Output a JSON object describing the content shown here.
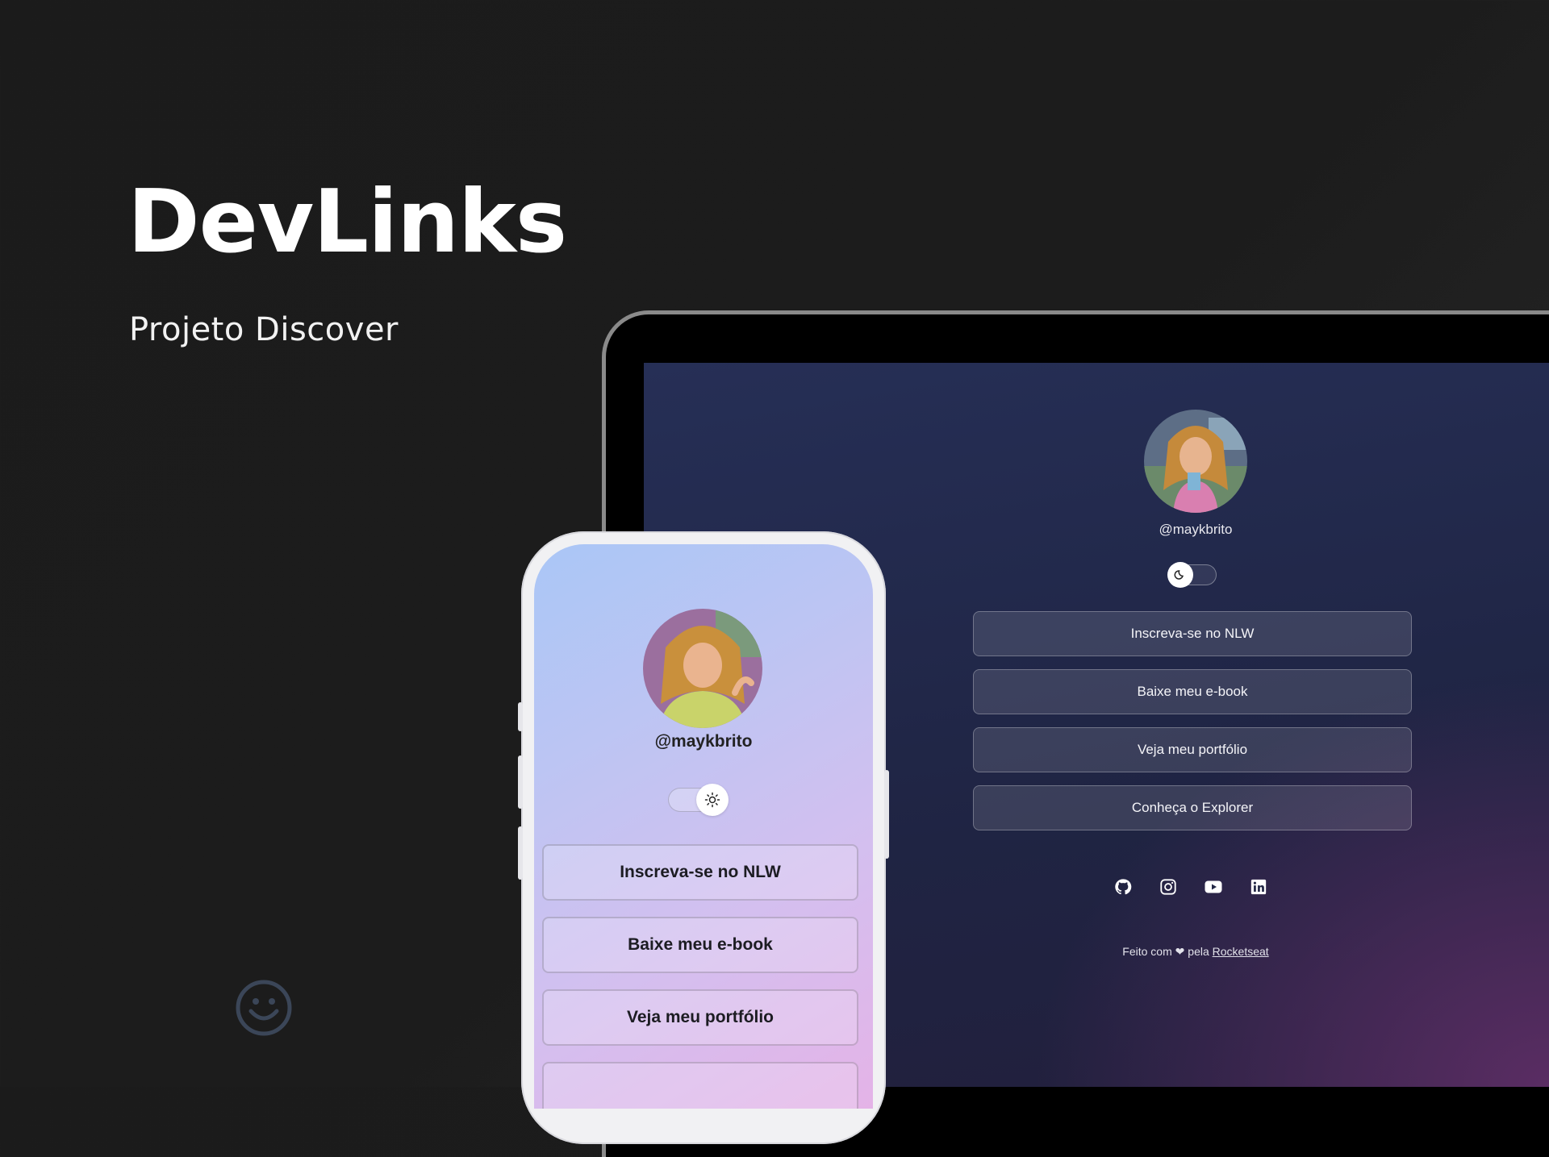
{
  "hero": {
    "title": "DevLinks",
    "subtitle": "Projeto Discover"
  },
  "desktop": {
    "username": "@maykbrito",
    "theme_toggle": {
      "state": "dark",
      "icon": "moon-icon"
    },
    "links": [
      {
        "label": "Inscreva-se no NLW"
      },
      {
        "label": "Baixe meu e-book"
      },
      {
        "label": "Veja meu portfólio"
      },
      {
        "label": "Conheça o Explorer"
      }
    ],
    "social": [
      "github-icon",
      "instagram-icon",
      "youtube-icon",
      "linkedin-icon"
    ],
    "footer": {
      "prefix": "Feito com",
      "heart": "❤",
      "middle": "pela",
      "link": "Rocketseat"
    }
  },
  "mobile": {
    "username": "@maykbrito",
    "theme_toggle": {
      "state": "light",
      "icon": "sun-icon"
    },
    "links": [
      {
        "label": "Inscreva-se no NLW"
      },
      {
        "label": "Baixe meu e-book"
      },
      {
        "label": "Veja meu portfólio"
      }
    ]
  },
  "colors": {
    "page_bg": "#1c1c1c",
    "desktop_bg": "#232846",
    "mobile_gradient_start": "#aac6f6",
    "mobile_gradient_end": "#e4b3e7"
  }
}
